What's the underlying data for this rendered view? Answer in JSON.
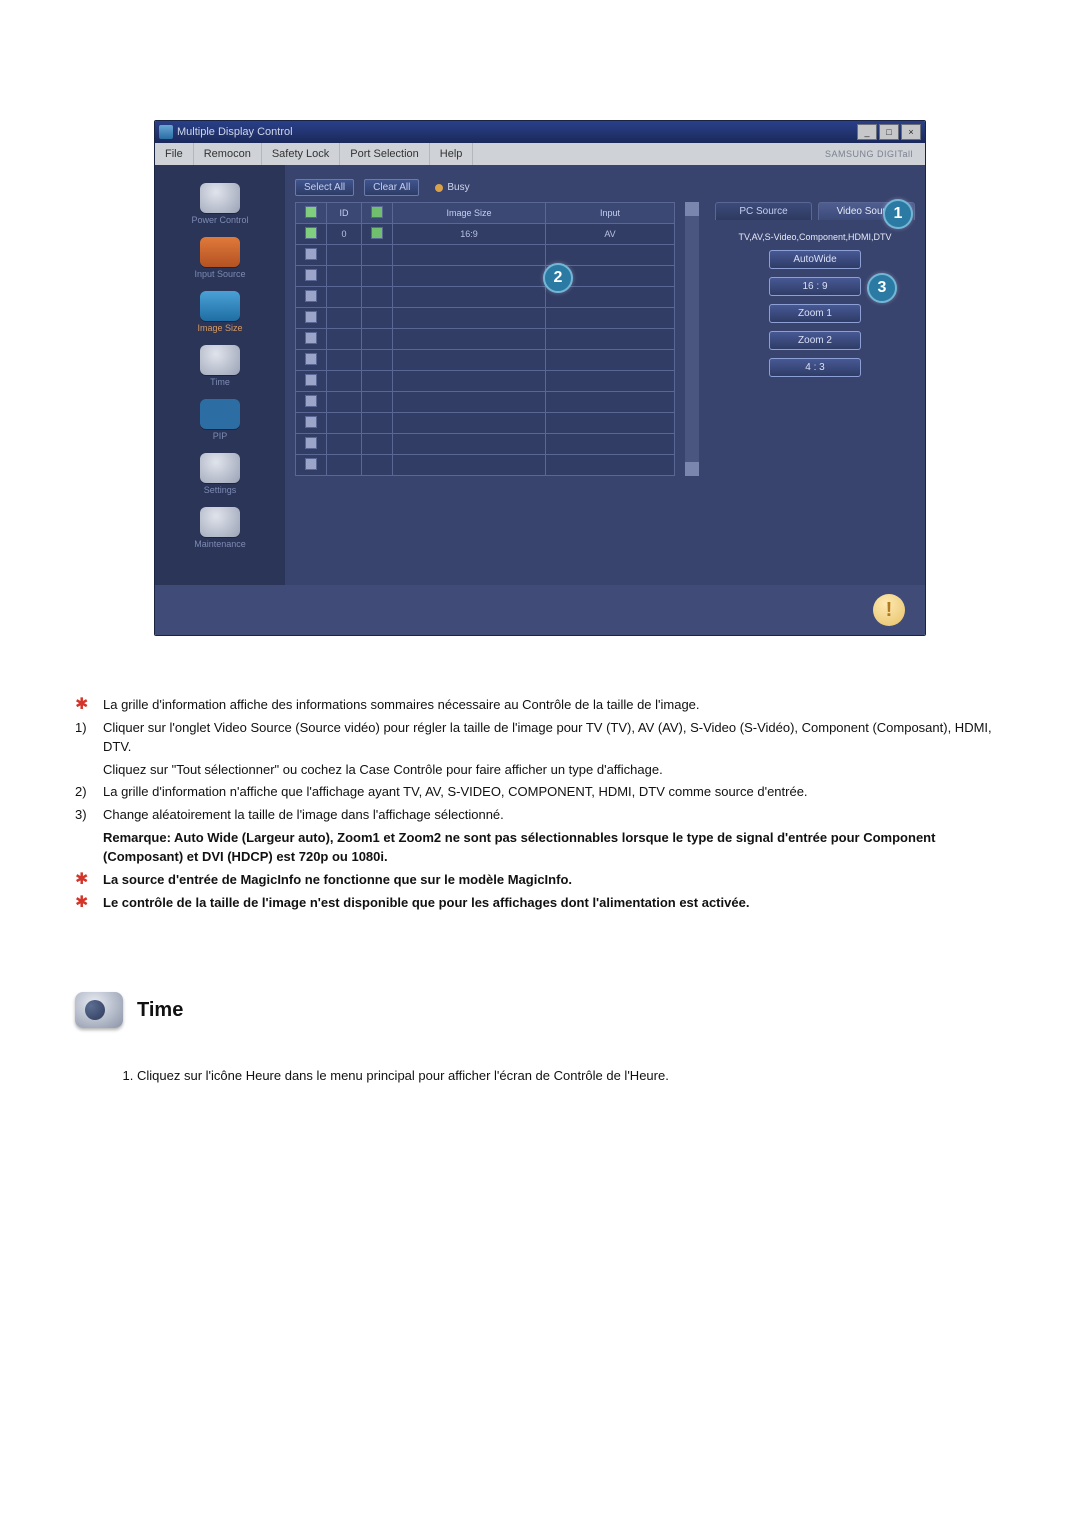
{
  "window": {
    "title": "Multiple Display Control",
    "brand": "SAMSUNG DIGITall"
  },
  "menus": [
    "File",
    "Remocon",
    "Safety Lock",
    "Port Selection",
    "Help"
  ],
  "sidebar": [
    {
      "label": "Power Control"
    },
    {
      "label": "Input Source"
    },
    {
      "label": "Image Size"
    },
    {
      "label": "Time"
    },
    {
      "label": "PIP"
    },
    {
      "label": "Settings"
    },
    {
      "label": "Maintenance"
    }
  ],
  "controls": {
    "select_all": "Select All",
    "clear_all": "Clear All",
    "busy": "Busy"
  },
  "grid": {
    "headers": [
      "",
      "ID",
      "",
      "Image Size",
      "Input"
    ],
    "row0": {
      "id": "0",
      "size": "16:9",
      "input": "AV"
    }
  },
  "right": {
    "pc_tab": "PC Source",
    "video_tab": "Video Source",
    "modes_title": "TV,AV,S-Video,Component,HDMI,DTV",
    "sizes": [
      "AutoWide",
      "16 : 9",
      "Zoom 1",
      "Zoom 2",
      "4 : 3"
    ]
  },
  "callouts": {
    "c1": "1",
    "c2": "2",
    "c3": "3"
  },
  "notes": {
    "star1": "La grille d'information affiche des informations sommaires nécessaire au Contrôle de la taille de l'image.",
    "n1": "1)",
    "t1a": "Cliquer sur l'onglet Video Source (Source vidéo) pour régler la taille de l'image pour TV (TV), AV (AV), S-Video (S-Vidéo), Component (Composant), HDMI, DTV.",
    "t1b": "Cliquez sur \"Tout sélectionner\" ou cochez la Case Contrôle pour faire afficher un type d'affichage.",
    "n2": "2)",
    "t2": "La grille d'information n'affiche que l'affichage ayant TV, AV, S-VIDEO, COMPONENT, HDMI, DTV comme source d'entrée.",
    "n3": "3)",
    "t3a": "Change aléatoirement la taille de l'image dans l'affichage sélectionné.",
    "t3b": "Remarque: Auto Wide (Largeur auto), Zoom1 et Zoom2 ne sont pas sélectionnables lorsque le type de signal d'entrée pour Component (Composant) et DVI (HDCP) est 720p ou 1080i.",
    "star2": "La source d'entrée de MagicInfo ne fonctionne que sur le modèle MagicInfo.",
    "star3": "Le contrôle de la taille de l'image n'est disponible que pour les affichages dont l'alimentation est activée."
  },
  "time_section": {
    "heading": "Time",
    "item1": "Cliquez sur l'icône Heure dans le menu principal pour afficher l'écran de Contrôle de l'Heure."
  }
}
